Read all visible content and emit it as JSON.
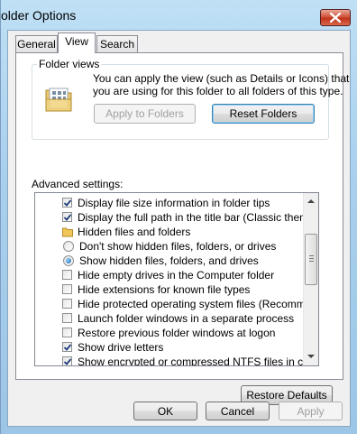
{
  "window": {
    "title": "older Options",
    "close_icon": "close-icon"
  },
  "tabs": [
    {
      "label": "General",
      "active": false
    },
    {
      "label": "View",
      "active": true
    },
    {
      "label": "Search",
      "active": false
    }
  ],
  "folder_views": {
    "group_label": "Folder views",
    "description_line1": "You can apply the view (such as Details or Icons) that",
    "description_line2": "you are using for this folder to all folders of this type.",
    "icon": "folder-view-icon",
    "apply_button": "Apply to Folders",
    "apply_enabled": false,
    "reset_button": "Reset Folders"
  },
  "advanced": {
    "label": "Advanced settings:",
    "items": [
      {
        "type": "checkbox",
        "label": "Display file size information in folder tips",
        "checked": true,
        "indent": 0
      },
      {
        "type": "checkbox",
        "label": "Display the full path in the title bar (Classic theme only)",
        "checked": true,
        "indent": 0
      },
      {
        "type": "folder",
        "label": "Hidden files and folders",
        "icon": "folder-icon",
        "indent": 0
      },
      {
        "type": "radio",
        "label": "Don't show hidden files, folders, or drives",
        "checked": false,
        "indent": 1
      },
      {
        "type": "radio",
        "label": "Show hidden files, folders, and drives",
        "checked": true,
        "indent": 1
      },
      {
        "type": "checkbox",
        "label": "Hide empty drives in the Computer folder",
        "checked": false,
        "indent": 0
      },
      {
        "type": "checkbox",
        "label": "Hide extensions for known file types",
        "checked": false,
        "indent": 0
      },
      {
        "type": "checkbox",
        "label": "Hide protected operating system files (Recommended)",
        "checked": false,
        "indent": 0
      },
      {
        "type": "checkbox",
        "label": "Launch folder windows in a separate process",
        "checked": false,
        "indent": 0
      },
      {
        "type": "checkbox",
        "label": "Restore previous folder windows at logon",
        "checked": false,
        "indent": 0
      },
      {
        "type": "checkbox",
        "label": "Show drive letters",
        "checked": true,
        "indent": 0
      },
      {
        "type": "checkbox",
        "label": "Show encrypted or compressed NTFS files in color",
        "checked": true,
        "indent": 0
      }
    ]
  },
  "restore_defaults_button": "Restore Defaults",
  "footer": {
    "ok": "OK",
    "cancel": "Cancel",
    "apply": "Apply",
    "apply_enabled": false
  },
  "colors": {
    "frame": "#a9d0ee",
    "client_bg": "#f0f0f0",
    "check_mark": "#1f3d7a",
    "close_red": "#c2331a"
  }
}
